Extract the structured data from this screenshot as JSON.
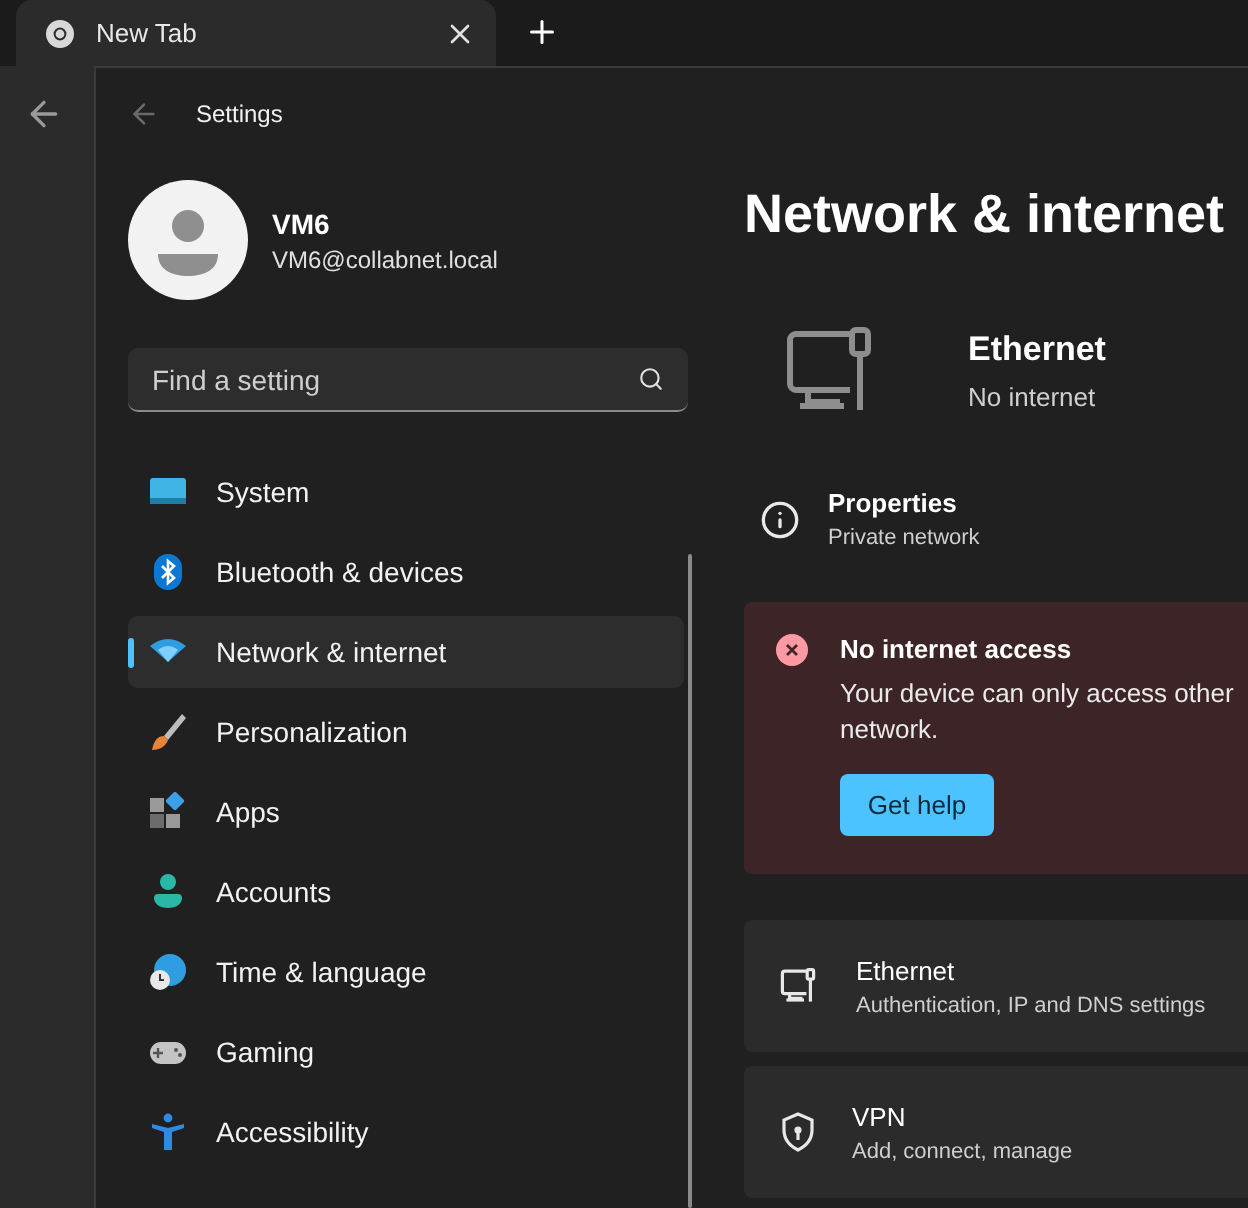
{
  "browser": {
    "tabs": [
      {
        "title": "New Tab",
        "selected": true
      }
    ]
  },
  "settings": {
    "title": "Settings",
    "user": {
      "name": "VM6",
      "email": "VM6@collabnet.local"
    },
    "search": {
      "placeholder": "Find a setting"
    },
    "nav": [
      {
        "label": "System",
        "selected": false
      },
      {
        "label": "Bluetooth & devices",
        "selected": false
      },
      {
        "label": "Network & internet",
        "selected": true
      },
      {
        "label": "Personalization",
        "selected": false
      },
      {
        "label": "Apps",
        "selected": false
      },
      {
        "label": "Accounts",
        "selected": false
      },
      {
        "label": "Time & language",
        "selected": false
      },
      {
        "label": "Gaming",
        "selected": false
      },
      {
        "label": "Accessibility",
        "selected": false
      }
    ]
  },
  "page": {
    "title": "Network & internet",
    "connection": {
      "name": "Ethernet",
      "status": "No internet"
    },
    "properties": {
      "title": "Properties",
      "subtitle": "Private network"
    },
    "alert": {
      "title": "No internet access",
      "message_lines": [
        "Your device can only access other",
        "network."
      ],
      "button": "Get help"
    },
    "cards": [
      {
        "title": "Ethernet",
        "subtitle": "Authentication, IP and DNS settings"
      },
      {
        "title": "VPN",
        "subtitle": "Add, connect, manage"
      }
    ]
  }
}
